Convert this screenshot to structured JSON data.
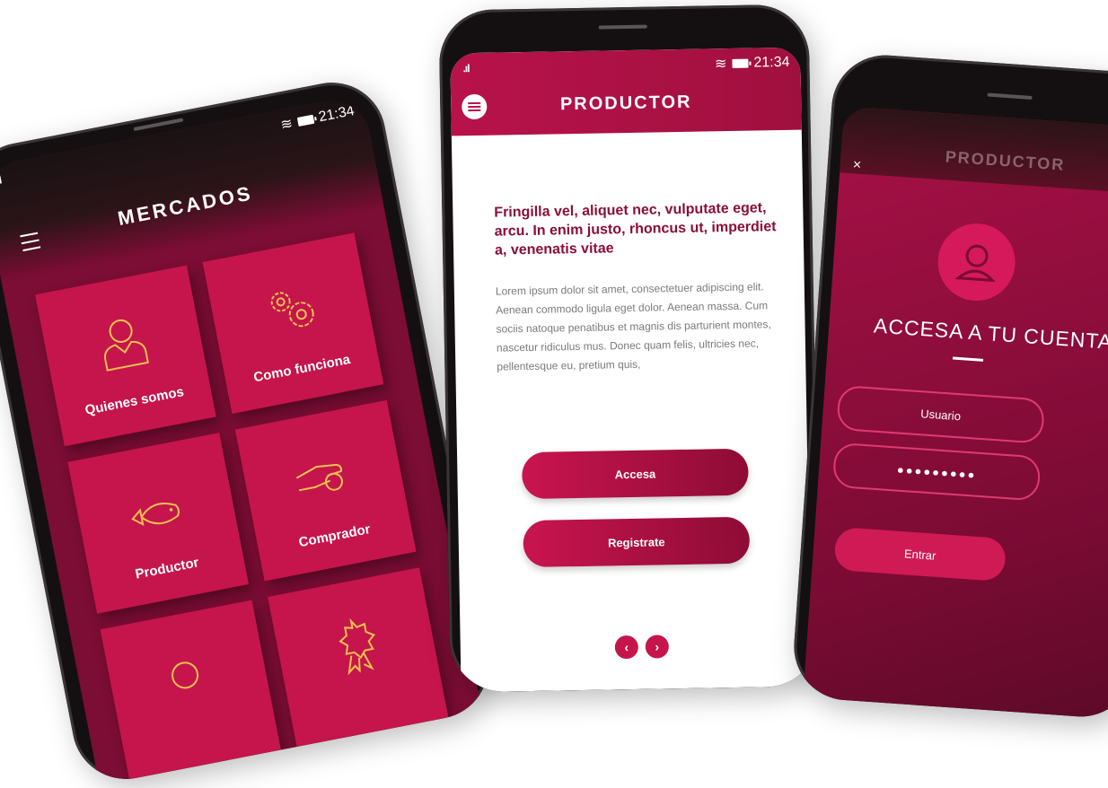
{
  "status": {
    "time": "21:34"
  },
  "left_screen": {
    "title": "MERCADOS",
    "tiles": [
      {
        "label": "Quienes somos",
        "icon": "person-icon"
      },
      {
        "label": "Como funciona",
        "icon": "gears-icon"
      },
      {
        "label": "Productor",
        "icon": "fish-icon"
      },
      {
        "label": "Comprador",
        "icon": "hand-coin-icon"
      },
      {
        "label": "",
        "icon": "search-icon"
      },
      {
        "label": "",
        "icon": "award-icon"
      }
    ]
  },
  "center_screen": {
    "title": "PRODUCTOR",
    "headline": "Fringilla vel, aliquet nec, vulputate eget, arcu. In enim justo, rhoncus ut, imperdiet a, venenatis vitae",
    "body": "Lorem ipsum dolor sit amet, consectetuer adipiscing elit. Aenean commodo ligula eget dolor. Aenean massa. Cum sociis natoque penatibus et magnis dis parturient montes, nascetur ridiculus mus. Donec quam felis, ultricies nec, pellentesque eu, pretium quis,",
    "buttons": {
      "access": "Accesa",
      "register": "Registrate"
    },
    "pager": {
      "prev": "‹",
      "next": "›"
    }
  },
  "right_screen": {
    "title": "PRODUCTOR",
    "close": "×",
    "heading": "ACCESA A TU CUENTA",
    "user_field": "Usuario",
    "password_field": "●●●●●●●●●",
    "submit": "Entrar"
  },
  "colors": {
    "primary": "#c5154c",
    "dark": "#7c0d34",
    "text_accent": "#8a0f36"
  }
}
